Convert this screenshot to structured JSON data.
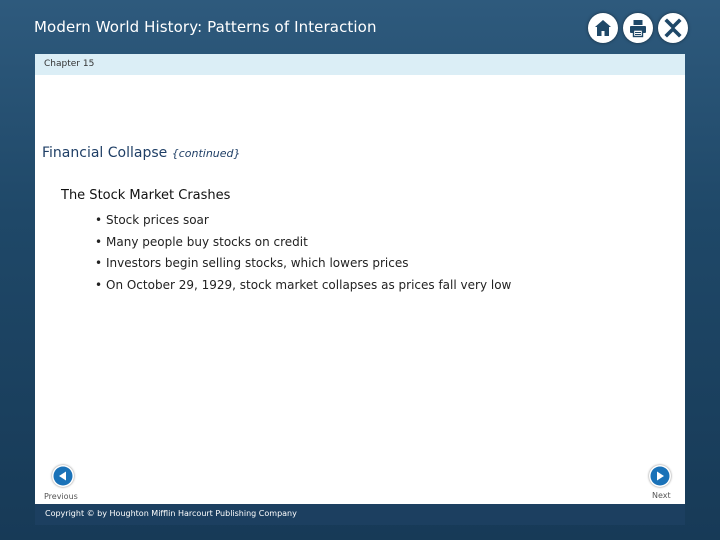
{
  "header": {
    "app_title": "Modern World History: Patterns of Interaction",
    "icons": [
      "home-icon",
      "print-icon",
      "close-icon"
    ]
  },
  "slide": {
    "chapter": "Chapter 15",
    "title": "Financial Collapse",
    "title_suffix": "{continued}",
    "subhead": "The Stock Market Crashes",
    "bullets": [
      "Stock prices soar",
      "Many people buy stocks on credit",
      "Investors begin selling stocks, which lowers prices",
      "On October 29, 1929, stock market collapses as  prices fall very low"
    ]
  },
  "nav": {
    "previous_label": "Previous",
    "next_label": "Next"
  },
  "footer": {
    "copyright": "Copyright © by Houghton Mifflin Harcourt Publishing Company"
  },
  "colors": {
    "frame_blue": "#1f4868",
    "accent_blue": "#1a72b8",
    "chapter_bar": "#dbeef6",
    "title_text": "#1f3f66"
  }
}
